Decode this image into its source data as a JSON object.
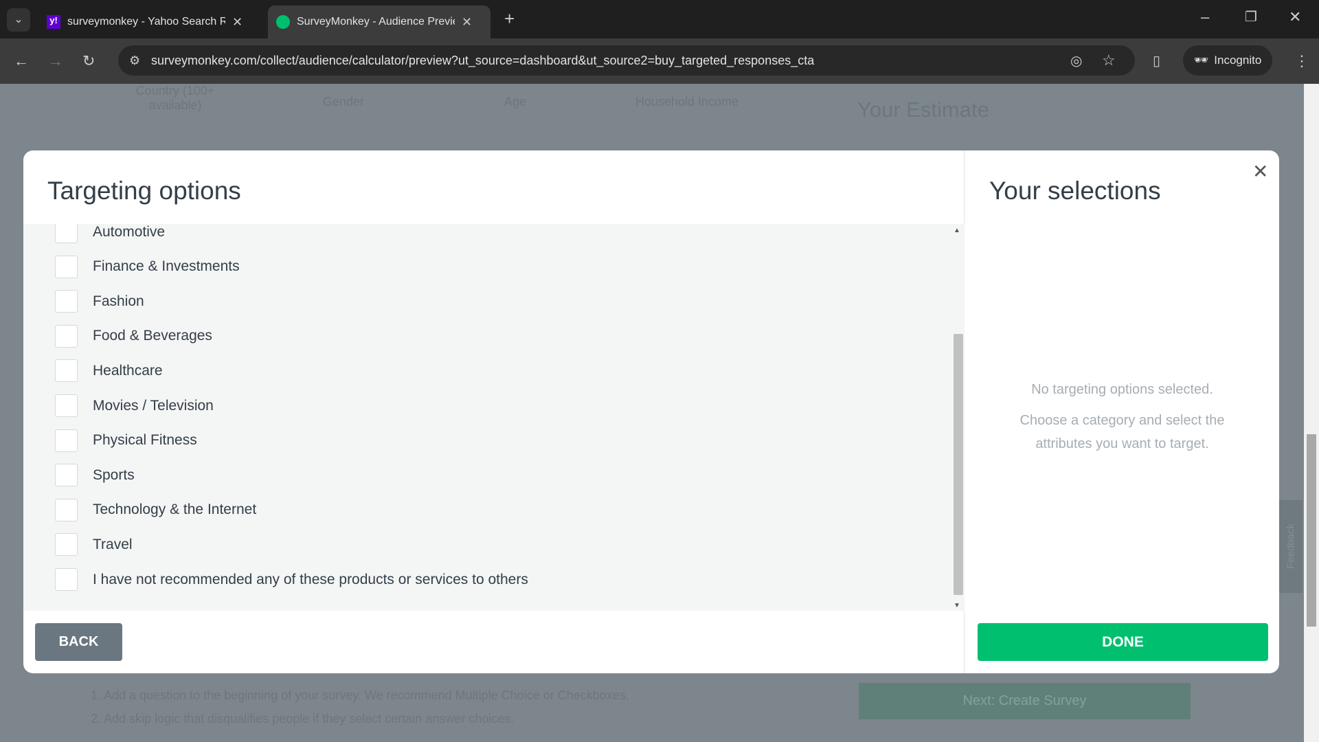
{
  "browser": {
    "tabs": [
      {
        "title": "surveymonkey - Yahoo Search Results",
        "icon": "yahoo-icon"
      },
      {
        "title": "SurveyMonkey - Audience Preview",
        "icon": "surveymonkey-icon"
      }
    ],
    "url": "surveymonkey.com/collect/audience/calculator/preview?ut_source=dashboard&ut_source2=buy_targeted_responses_cta",
    "incognito": "Incognito"
  },
  "background": {
    "columns": [
      "Country (100+ available)",
      "Gender",
      "Age",
      "Household Income"
    ],
    "estimate": "Your Estimate",
    "steps": [
      "1. Add a question to the beginning of your survey. We recommend Multiple Choice or Checkboxes.",
      "2. Add skip logic that disqualifies people if they select certain answer choices."
    ],
    "next_button": "Next: Create Survey",
    "feedback": "Feedback"
  },
  "modal": {
    "title": "Targeting options",
    "options": [
      "Automotive",
      "Finance & Investments",
      "Fashion",
      "Food & Beverages",
      "Healthcare",
      "Movies / Television",
      "Physical Fitness",
      "Sports",
      "Technology & the Internet",
      "Travel",
      "I have not recommended any of these products or services to others"
    ],
    "back": "BACK",
    "selections_title": "Your selections",
    "empty_line1": "No targeting options selected.",
    "empty_line2": "Choose a category and select the attributes you want to target.",
    "done": "DONE",
    "accent": "#00bf6f"
  }
}
